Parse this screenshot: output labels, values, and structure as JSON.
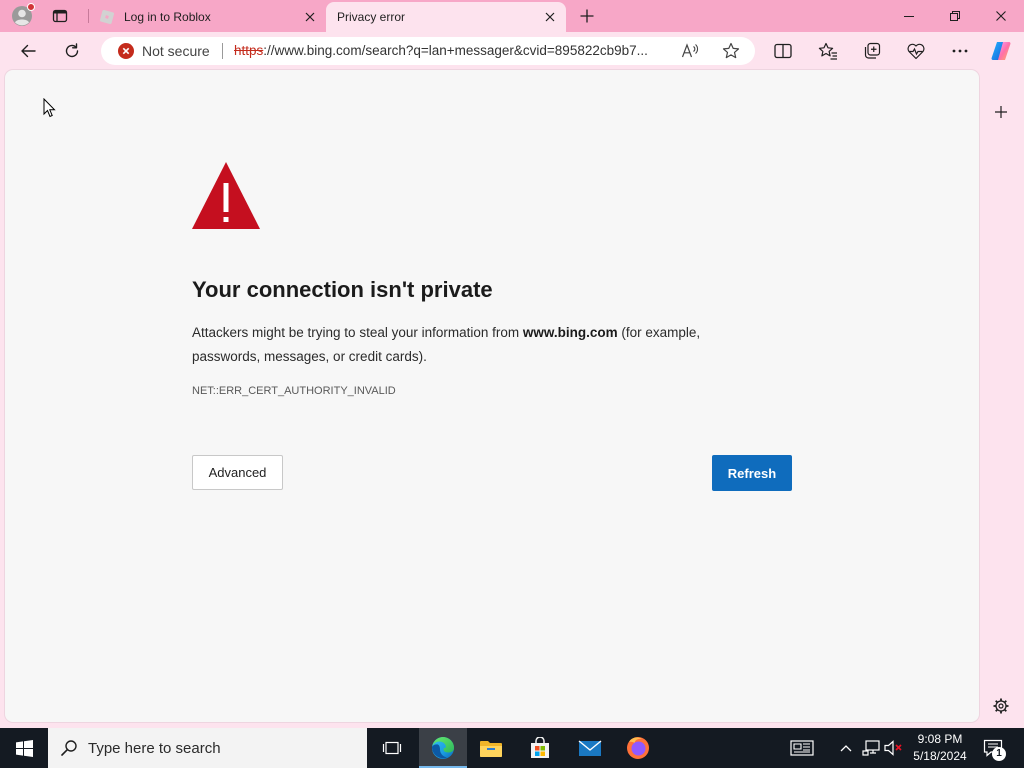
{
  "browser": {
    "tabs": [
      {
        "title": "Log in to Roblox",
        "favicon": "roblox-favicon-icon",
        "active": false
      },
      {
        "title": "Privacy error",
        "active": true
      }
    ],
    "address_bar": {
      "security_icon": "not-secure-icon",
      "security_label": "Not secure",
      "url_scheme": "https",
      "url_rest": "://www.bing.com/search?q=lan+messager&cvid=895822cb9b7..."
    },
    "toolbar_icons": [
      "back-arrow-icon",
      "refresh-icon",
      "read-aloud-icon",
      "add-favorite-star-icon",
      "split-screen-icon",
      "favorites-icon",
      "collections-icon",
      "browser-essentials-icon",
      "more-menu-icon",
      "copilot-icon"
    ],
    "sidebar_icons": [
      "add-sidebar-app-icon",
      "sidebar-settings-icon"
    ]
  },
  "page": {
    "icon": "warning-triangle-icon",
    "heading": "Your connection isn't private",
    "description": {
      "before": "Attackers might be trying to steal your information from ",
      "domain": "www.bing.com",
      "after": " (for example, passwords, messages, or credit cards)."
    },
    "error_code": "NET::ERR_CERT_AUTHORITY_INVALID",
    "advanced_button": "Advanced",
    "refresh_button": "Refresh"
  },
  "taskbar": {
    "search_placeholder": "Type here to search",
    "pinned_apps": [
      "task-view-icon",
      "microsoft-edge-icon",
      "file-explorer-icon",
      "microsoft-store-icon",
      "mail-icon",
      "firefox-icon"
    ],
    "active_app": "microsoft-edge-icon",
    "tray_icons": [
      "news-and-interests-icon",
      "show-hidden-icons-chevron-icon",
      "network-icon",
      "volume-muted-icon",
      "action-center-icon"
    ],
    "clock": {
      "time": "9:08 PM",
      "date": "5/18/2024"
    },
    "notification_count": "1"
  },
  "colors": {
    "tab_strip": "#f7a7c7",
    "toolbar": "#fde3ee",
    "page_background": "#f7f7f7",
    "warning_red": "#c50f1f",
    "not_secure_red": "#c42b1c",
    "primary_button": "#0f6cbd",
    "taskbar": "#141a22"
  }
}
